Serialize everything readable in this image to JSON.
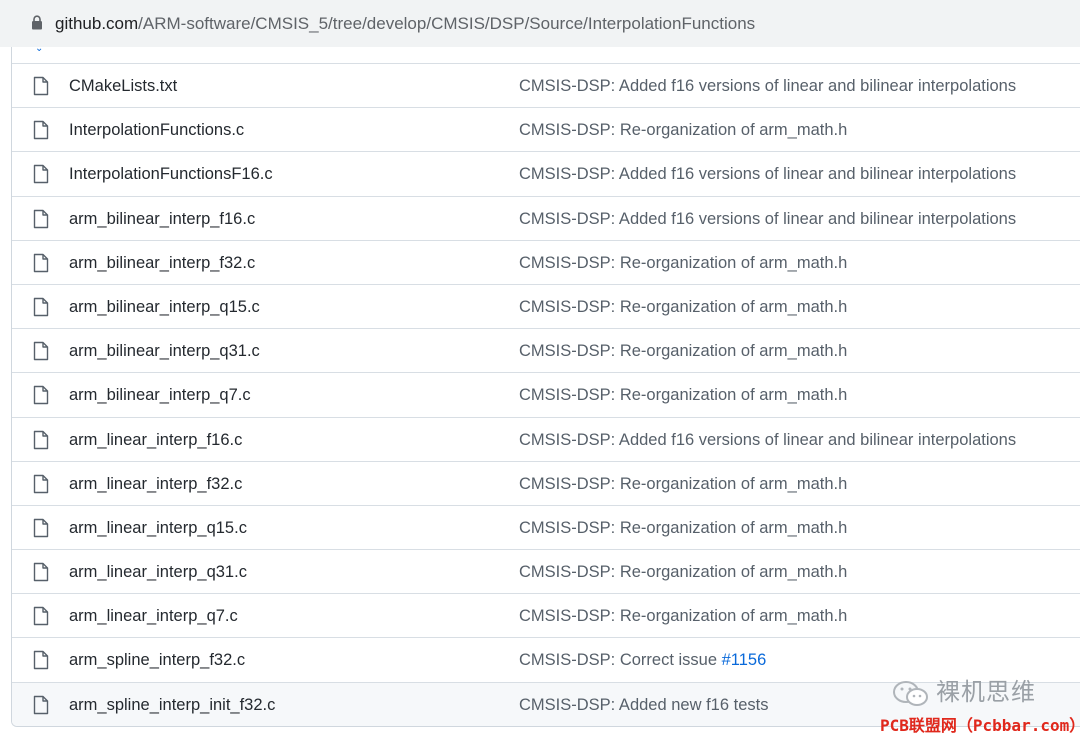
{
  "address_bar": {
    "host": "github.com",
    "path": "/ARM-software/CMSIS_5/tree/develop/CMSIS/DSP/Source/InterpolationFunctions"
  },
  "files": [
    {
      "name": "CMakeLists.txt",
      "message": "CMSIS-DSP: Added f16 versions of linear and bilinear interpolations"
    },
    {
      "name": "InterpolationFunctions.c",
      "message": "CMSIS-DSP: Re-organization of arm_math.h"
    },
    {
      "name": "InterpolationFunctionsF16.c",
      "message": "CMSIS-DSP: Added f16 versions of linear and bilinear interpolations"
    },
    {
      "name": "arm_bilinear_interp_f16.c",
      "message": "CMSIS-DSP: Added f16 versions of linear and bilinear interpolations"
    },
    {
      "name": "arm_bilinear_interp_f32.c",
      "message": "CMSIS-DSP: Re-organization of arm_math.h"
    },
    {
      "name": "arm_bilinear_interp_q15.c",
      "message": "CMSIS-DSP: Re-organization of arm_math.h"
    },
    {
      "name": "arm_bilinear_interp_q31.c",
      "message": "CMSIS-DSP: Re-organization of arm_math.h"
    },
    {
      "name": "arm_bilinear_interp_q7.c",
      "message": "CMSIS-DSP: Re-organization of arm_math.h"
    },
    {
      "name": "arm_linear_interp_f16.c",
      "message": "CMSIS-DSP: Added f16 versions of linear and bilinear interpolations"
    },
    {
      "name": "arm_linear_interp_f32.c",
      "message": "CMSIS-DSP: Re-organization of arm_math.h"
    },
    {
      "name": "arm_linear_interp_q15.c",
      "message": "CMSIS-DSP: Re-organization of arm_math.h"
    },
    {
      "name": "arm_linear_interp_q31.c",
      "message": "CMSIS-DSP: Re-organization of arm_math.h"
    },
    {
      "name": "arm_linear_interp_q7.c",
      "message": "CMSIS-DSP: Re-organization of arm_math.h"
    },
    {
      "name": "arm_spline_interp_f32.c",
      "message": "CMSIS-DSP: Correct issue ",
      "issue_link": "#1156"
    },
    {
      "name": "arm_spline_interp_init_f32.c",
      "message": "CMSIS-DSP: Added new f16 tests"
    }
  ],
  "watermark": {
    "wechat_text": "裸机思维",
    "site_text": "PCB联盟网（Pcbbar.com）"
  },
  "colors": {
    "link": "#0969da",
    "muted_text": "#57606a",
    "border": "#d0d7de",
    "watermark_red": "#e0281c"
  }
}
